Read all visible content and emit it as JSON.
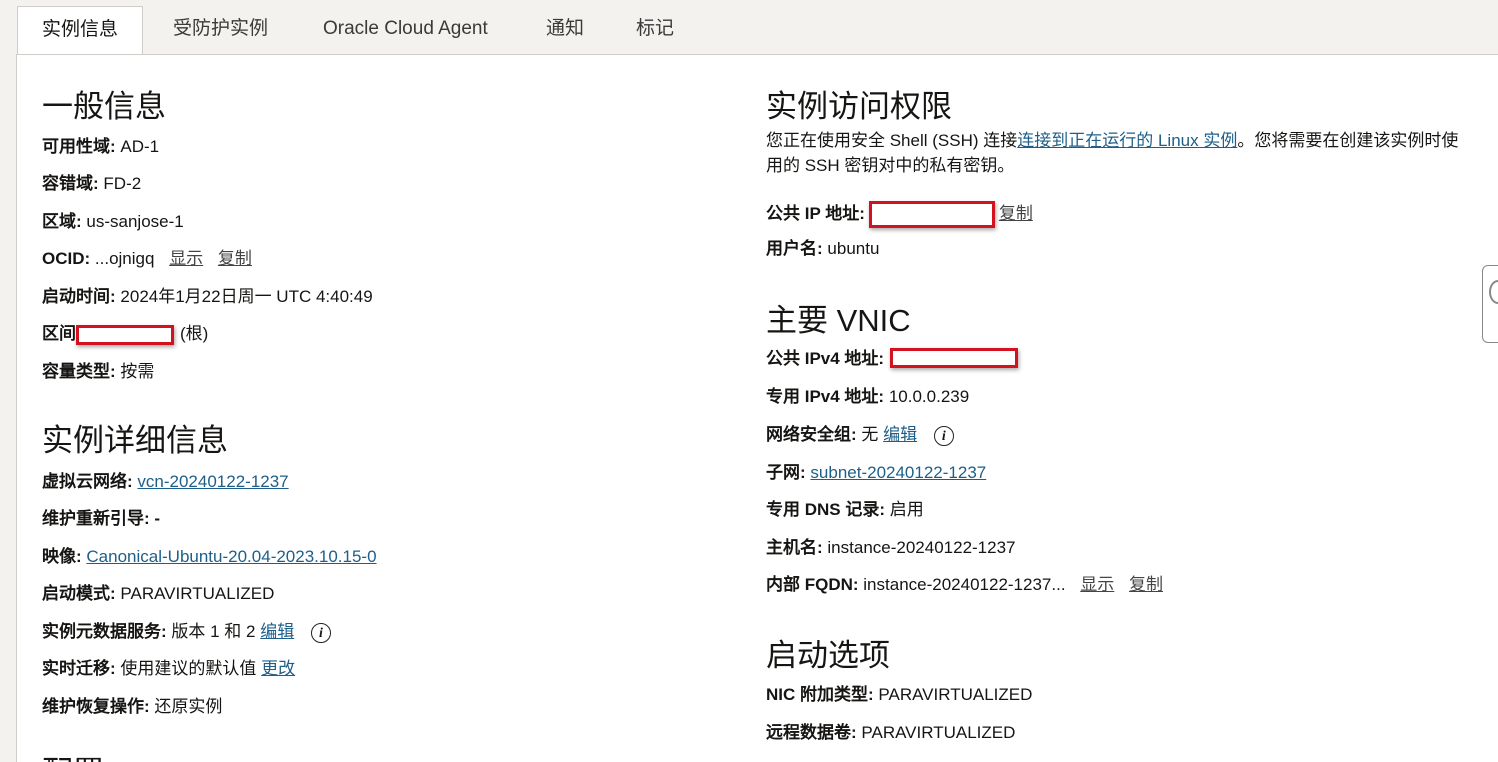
{
  "tabs": [
    "实例信息",
    "受防护实例",
    "Oracle Cloud Agent",
    "通知",
    "标记"
  ],
  "general": {
    "heading": "一般信息",
    "availability_domain_label": "可用性域:",
    "availability_domain_value": "AD-1",
    "fault_domain_label": "容错域:",
    "fault_domain_value": "FD-2",
    "region_label": "区域:",
    "region_value": "us-sanjose-1",
    "ocid_label": "OCID:",
    "ocid_value": "...ojnigq",
    "ocid_show": "显示",
    "ocid_copy": "复制",
    "launch_time_label": "启动时间:",
    "launch_time_value": "2024年1月22日周一 UTC 4:40:49",
    "compartment_label": "区间",
    "compartment_suffix": "(根)",
    "capacity_type_label": "容量类型:",
    "capacity_type_value": "按需"
  },
  "instance_details": {
    "heading": "实例详细信息",
    "vcn_label": "虚拟云网络:",
    "vcn_value": "vcn-20240122-1237",
    "maint_reboot_label": "维护重新引导:",
    "maint_reboot_value": "-",
    "image_label": "映像:",
    "image_value": "Canonical-Ubuntu-20.04-2023.10.15-0",
    "launch_mode_label": "启动模式:",
    "launch_mode_value": "PARAVIRTUALIZED",
    "metadata_label": "实例元数据服务:",
    "metadata_value": "版本 1 和 2",
    "metadata_edit": "编辑",
    "live_migration_label": "实时迁移:",
    "live_migration_value": "使用建议的默认值",
    "live_migration_change": "更改",
    "maint_recovery_label": "维护恢复操作:",
    "maint_recovery_value": "还原实例"
  },
  "next_heading_partial": "配置",
  "access": {
    "heading": "实例访问权限",
    "desc_prefix": "您正在使用安全 Shell (SSH) 连接",
    "desc_link": "连接到正在运行的 Linux 实例",
    "desc_suffix": "。您将需要在创建该实例时使",
    "desc_line2": "用的 SSH 密钥对中的私有密钥。",
    "public_ip_label": "公共 IP 地址:",
    "public_ip_copy": "复制",
    "username_label": "用户名:",
    "username_value": "ubuntu"
  },
  "vnic": {
    "heading": "主要 VNIC",
    "public_ipv4_label": "公共 IPv4 地址:",
    "private_ipv4_label": "专用 IPv4 地址:",
    "private_ipv4_value": "10.0.0.239",
    "nsg_label": "网络安全组:",
    "nsg_value": "无",
    "nsg_edit": "编辑",
    "subnet_label": "子网:",
    "subnet_value": "subnet-20240122-1237",
    "private_dns_label": "专用 DNS 记录:",
    "private_dns_value": "启用",
    "hostname_label": "主机名:",
    "hostname_value": "instance-20240122-1237",
    "fqdn_label": "内部 FQDN:",
    "fqdn_value": "instance-20240122-1237...",
    "fqdn_show": "显示",
    "fqdn_copy": "复制"
  },
  "launch_options": {
    "heading": "启动选项",
    "nic_label": "NIC 附加类型:",
    "nic_value": "PARAVIRTUALIZED",
    "remote_volume_label": "远程数据卷:",
    "remote_volume_value": "PARAVIRTUALIZED"
  },
  "icons": {
    "info": "info-icon",
    "side_widget": "feedback-widget-icon"
  }
}
